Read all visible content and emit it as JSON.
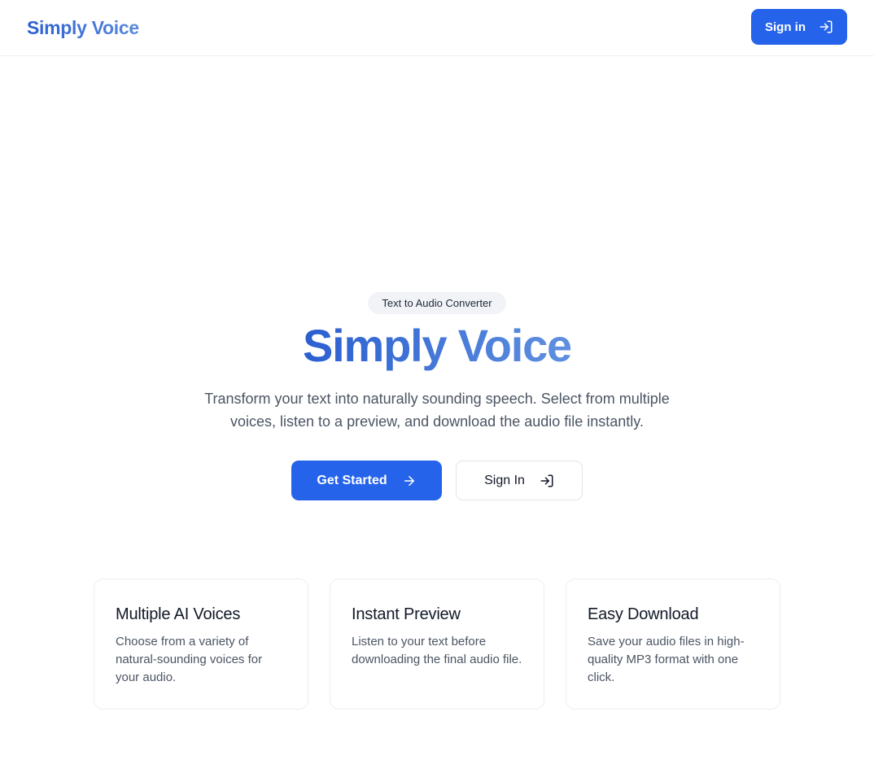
{
  "header": {
    "logo": "Simply Voice",
    "sign_in_label": "Sign in",
    "sign_in_icon": "sign-in-icon"
  },
  "hero": {
    "badge": "Text to Audio Converter",
    "title": "Simply Voice",
    "subtitle": "Transform your text into naturally sounding speech. Select from multiple voices, listen to a preview, and download the audio file instantly.",
    "primary_cta": {
      "label": "Get Started",
      "icon": "arrow-right-icon"
    },
    "secondary_cta": {
      "label": "Sign In",
      "icon": "sign-in-icon"
    }
  },
  "features": [
    {
      "title": "Multiple AI Voices",
      "description": "Choose from a variety of natural-sounding voices for your audio."
    },
    {
      "title": "Instant Preview",
      "description": "Listen to your text before downloading the final audio file."
    },
    {
      "title": "Easy Download",
      "description": "Save your audio files in high-quality MP3 format with one click."
    }
  ],
  "colors": {
    "primary": "#2563eb",
    "gradient_start": "#2b5fd0",
    "gradient_end": "#5f90df",
    "muted_text": "#4b5563",
    "badge_bg": "#f1f3f6"
  }
}
